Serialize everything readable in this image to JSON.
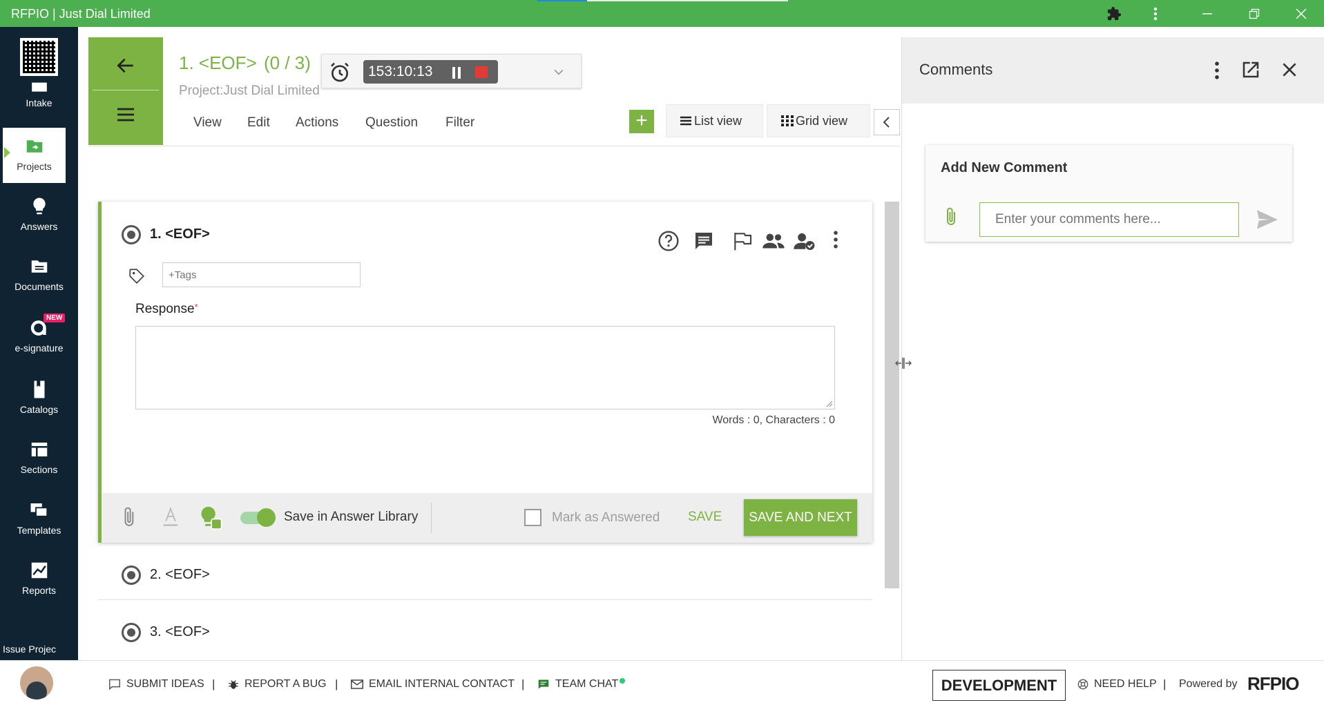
{
  "window": {
    "title": "RFPIO | Just Dial Limited"
  },
  "sidebar": {
    "items": [
      {
        "label": "Intake"
      },
      {
        "label": "Projects"
      },
      {
        "label": "Answers"
      },
      {
        "label": "Documents"
      },
      {
        "label": "e-signature",
        "badge": "NEW"
      },
      {
        "label": "Catalogs"
      },
      {
        "label": "Sections"
      },
      {
        "label": "Templates"
      },
      {
        "label": "Reports"
      }
    ],
    "issue_label": "Issue Projec"
  },
  "header": {
    "question_title": "1. <EOF>",
    "question_count": "(0 / 3)",
    "project": "Project:Just Dial Limited",
    "timer": "153:10:13",
    "menu": [
      "View",
      "Edit",
      "Actions",
      "Question",
      "Filter"
    ],
    "list_view": "List view",
    "grid_view": "Grid view"
  },
  "question": {
    "title": "1. <EOF>",
    "tags_placeholder": "+Tags",
    "response_label": "Response",
    "required_mark": "*",
    "word_count": "Words : 0, Characters : 0",
    "save_in_library": "Save in Answer Library",
    "save_in_library_enabled": true,
    "mark_answered": "Mark as Answered",
    "save": "SAVE",
    "save_next": "SAVE AND NEXT"
  },
  "other_questions": [
    {
      "title": "2. <EOF>"
    },
    {
      "title": "3. <EOF>"
    }
  ],
  "comments": {
    "title": "Comments",
    "add_label": "Add New Comment",
    "placeholder": "Enter your comments here..."
  },
  "footer": {
    "submit_ideas": "SUBMIT IDEAS",
    "report_bug": "REPORT A BUG",
    "email_contact": "EMAIL INTERNAL CONTACT",
    "team_chat": "TEAM CHAT",
    "environment": "DEVELOPMENT",
    "need_help": "NEED HELP",
    "powered_by": "Powered by",
    "logo": "RFPIO"
  },
  "colors": {
    "accent": "#7cb342",
    "titlebar": "#4caf50",
    "sidebar": "#0f2333"
  }
}
